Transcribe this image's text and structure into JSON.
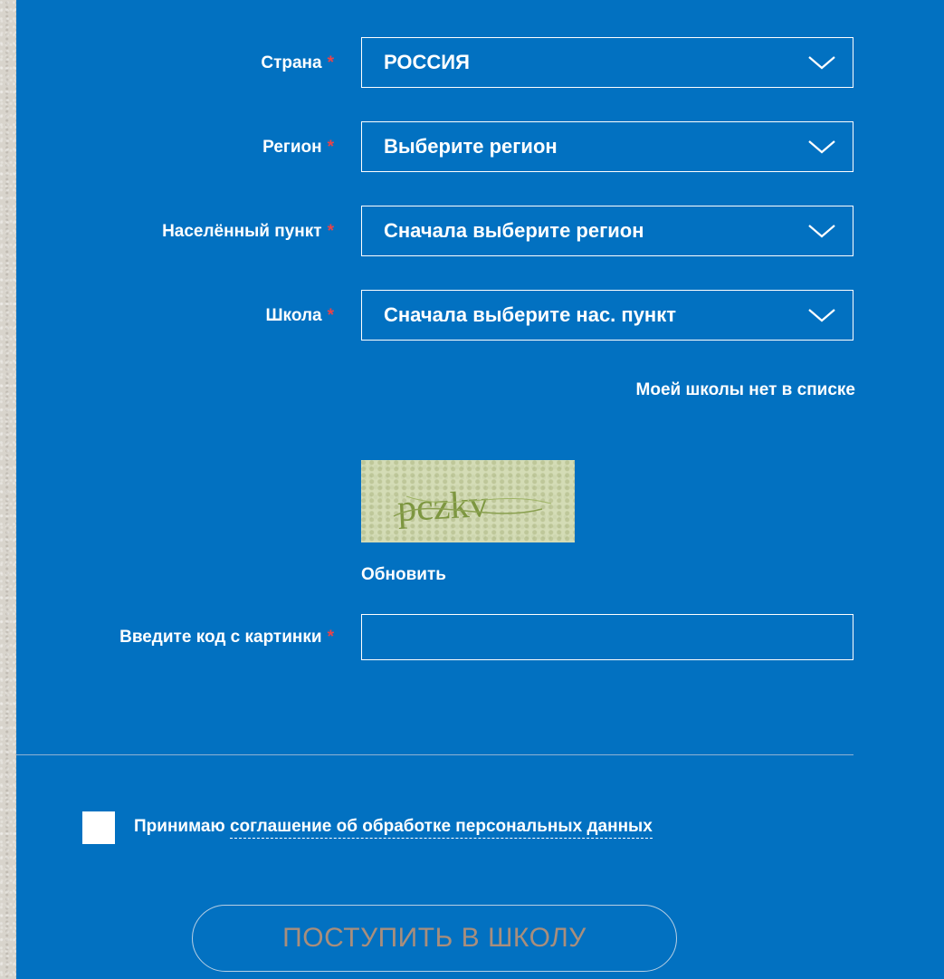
{
  "form": {
    "required_mark": "*",
    "country": {
      "label": "Страна",
      "value": "РОССИЯ"
    },
    "region": {
      "label": "Регион",
      "value": "Выберите регион"
    },
    "locality": {
      "label": "Населённый пункт",
      "value": "Сначала выберите регион"
    },
    "school": {
      "label": "Школа",
      "value": "Сначала выберите нас. пункт"
    },
    "no_school_link": "Моей школы нет в списке",
    "captcha": {
      "text": "pczkv",
      "refresh": "Обновить",
      "label": "Введите код с картинки",
      "value": ""
    },
    "agreement": {
      "prefix": "Принимаю",
      "link": "соглашение об обработке персональных данных",
      "checked": false
    },
    "submit": "ПОСТУПИТЬ В ШКОЛУ"
  },
  "colors": {
    "panel": "#0271c1",
    "required": "#e8444a",
    "submit_text": "#a98e7c"
  }
}
